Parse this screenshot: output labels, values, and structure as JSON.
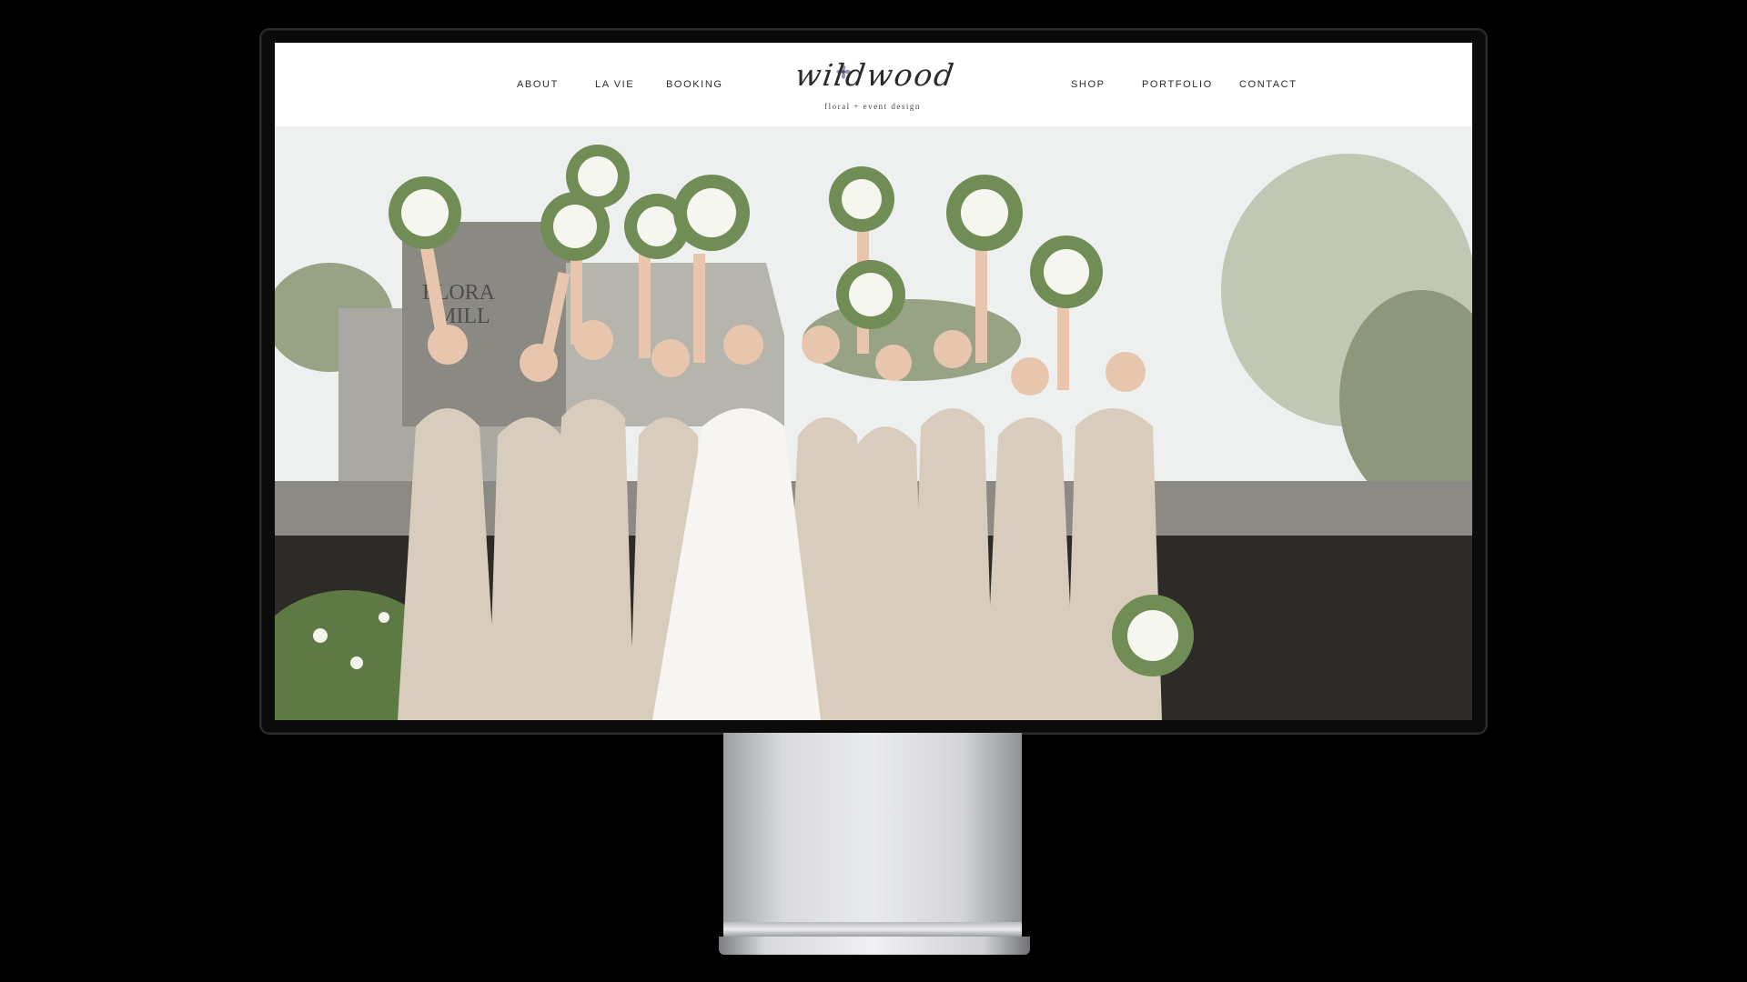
{
  "nav": {
    "left": [
      {
        "label": "ABOUT"
      },
      {
        "label": "LA VIE"
      },
      {
        "label": "BOOKING"
      }
    ],
    "right": [
      {
        "label": "SHOP"
      },
      {
        "label": "PORTFOLIO"
      },
      {
        "label": "CONTACT"
      }
    ]
  },
  "logo": {
    "script": "wildwood",
    "tagline": "floral + event design",
    "flower_color": "#8d7fa6"
  },
  "hero": {
    "image_description_icon": "bridal-party-photo",
    "sign_text_line1": "ELORA",
    "sign_text_line2": "MILL"
  },
  "colors": {
    "dress": "#d8cdbc",
    "greenery": "#5d7a45",
    "nav_text": "#2b2b2b"
  }
}
